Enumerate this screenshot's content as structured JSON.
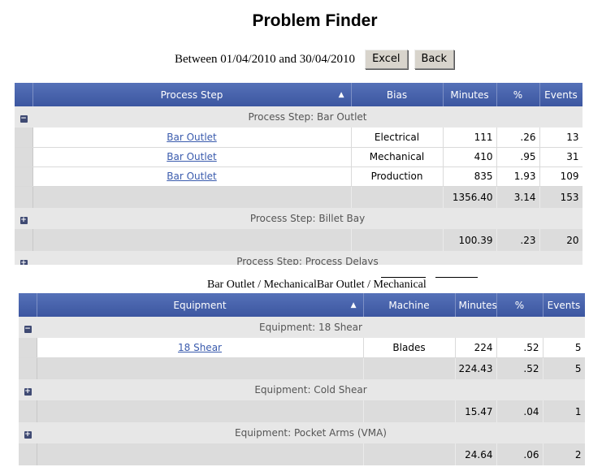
{
  "page": {
    "title": "Problem Finder",
    "date_range": "Between 01/04/2010 and 30/04/2010",
    "excel_label": "Excel",
    "back_label": "Back"
  },
  "grid1": {
    "headers": {
      "c1": "Process Step",
      "c2": "Bias",
      "c3": "Minutes",
      "c4": "%",
      "c5": "Events"
    },
    "groups": [
      {
        "label": "Process Step: Bar Outlet",
        "expanded": true,
        "rows": [
          {
            "name": "Bar Outlet",
            "bias": "Electrical",
            "minutes": "111",
            "pct": ".26",
            "events": "13"
          },
          {
            "name": "Bar Outlet",
            "bias": "Mechanical",
            "minutes": "410",
            "pct": ".95",
            "events": "31"
          },
          {
            "name": "Bar Outlet",
            "bias": "Production",
            "minutes": "835",
            "pct": "1.93",
            "events": "109"
          }
        ],
        "total": {
          "minutes": "1356.40",
          "pct": "3.14",
          "events": "153"
        }
      },
      {
        "label": "Process Step: Billet Bay",
        "expanded": false,
        "total": {
          "minutes": "100.39",
          "pct": ".23",
          "events": "20"
        }
      },
      {
        "label": "Process Step: Process Delays",
        "expanded": false
      }
    ]
  },
  "caption": {
    "text": "Bar Outlet / MechanicalBar Outlet / Mechanical"
  },
  "grid2": {
    "headers": {
      "c1": "Equipment",
      "c2": "Machine",
      "c3": "Minutes",
      "c4": "%",
      "c5": "Events"
    },
    "groups": [
      {
        "label": "Equipment: 18 Shear",
        "expanded": true,
        "rows": [
          {
            "name": "18 Shear",
            "machine": "Blades",
            "minutes": "224",
            "pct": ".52",
            "events": "5"
          }
        ],
        "total": {
          "minutes": "224.43",
          "pct": ".52",
          "events": "5"
        }
      },
      {
        "label": "Equipment: Cold Shear",
        "expanded": false,
        "total": {
          "minutes": "15.47",
          "pct": ".04",
          "events": "1"
        }
      },
      {
        "label": "Equipment: Pocket Arms (VMA)",
        "expanded": false,
        "total": {
          "minutes": "24.64",
          "pct": ".06",
          "events": "2"
        }
      }
    ]
  },
  "icons": {
    "expand": "plus-box-icon",
    "collapse": "minus-box-icon",
    "sort": "sort-asc-icon"
  }
}
